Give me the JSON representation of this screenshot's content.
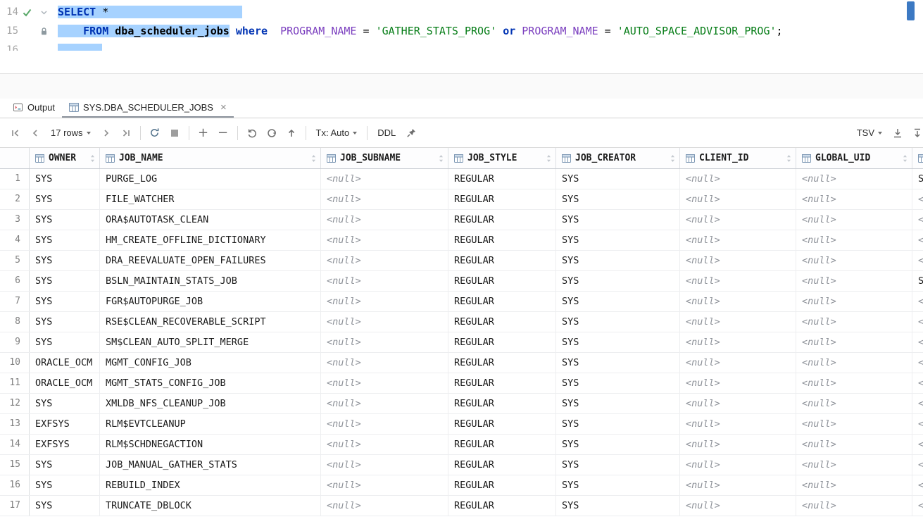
{
  "colors": {
    "selection": "#A6D2FF",
    "keyword": "#0033B3",
    "string": "#067D17",
    "field": "#7B3FBF",
    "scroll_marker": "#3C79C3",
    "null_text": "#8E9299"
  },
  "editor": {
    "lines": [
      {
        "number": "14",
        "g1": "check-icon",
        "g2": "fold-icon",
        "tokens": [
          {
            "t": "SELECT",
            "c": "kw",
            "s": true
          },
          {
            "t": " ",
            "c": "pln",
            "s": true
          },
          {
            "t": "*",
            "c": "pln",
            "s": true
          },
          {
            "t": "                     ",
            "c": "pln",
            "s": true
          }
        ]
      },
      {
        "number": "15",
        "g1": "",
        "g2": "lock-icon",
        "tokens": [
          {
            "t": "    ",
            "c": "pln",
            "s": true
          },
          {
            "t": "FROM",
            "c": "kw",
            "s": true
          },
          {
            "t": " ",
            "c": "pln",
            "s": true
          },
          {
            "t": "dba_scheduler_jobs",
            "c": "tbl",
            "s": true
          },
          {
            "t": " ",
            "c": "pln"
          },
          {
            "t": "where",
            "c": "kw"
          },
          {
            "t": "  ",
            "c": "pln"
          },
          {
            "t": "PROGRAM_NAME",
            "c": "fld"
          },
          {
            "t": " = ",
            "c": "pln"
          },
          {
            "t": "'GATHER_STATS_PROG'",
            "c": "str"
          },
          {
            "t": " ",
            "c": "pln"
          },
          {
            "t": "or",
            "c": "kw"
          },
          {
            "t": " ",
            "c": "pln"
          },
          {
            "t": "PROGRAM_NAME",
            "c": "fld"
          },
          {
            "t": " = ",
            "c": "pln"
          },
          {
            "t": "'AUTO_SPACE_ADVISOR_PROG'",
            "c": "str"
          },
          {
            "t": ";",
            "c": "pln"
          }
        ]
      },
      {
        "number": "16",
        "g1": "",
        "g2": "",
        "tokens": [
          {
            "t": "       ",
            "c": "pln",
            "s": true
          }
        ]
      }
    ]
  },
  "tabs": [
    {
      "label": "Output"
    },
    {
      "label": "SYS.DBA_SCHEDULER_JOBS"
    }
  ],
  "toolbar": {
    "rows_label": "17 rows",
    "tx_label": "Tx: Auto",
    "ddl_label": "DDL",
    "tsv_label": "TSV"
  },
  "grid": {
    "columns": [
      {
        "name": "OWNER"
      },
      {
        "name": "JOB_NAME"
      },
      {
        "name": "JOB_SUBNAME"
      },
      {
        "name": "JOB_STYLE"
      },
      {
        "name": "JOB_CREATOR"
      },
      {
        "name": "CLIENT_ID"
      },
      {
        "name": "GLOBAL_UID"
      },
      {
        "name": ""
      }
    ],
    "rows": [
      {
        "num": "1",
        "cells": [
          "SYS",
          "PURGE_LOG",
          "<null>",
          "REGULAR",
          "SYS",
          "<null>",
          "<null>",
          "SYS"
        ]
      },
      {
        "num": "2",
        "cells": [
          "SYS",
          "FILE_WATCHER",
          "<null>",
          "REGULAR",
          "SYS",
          "<null>",
          "<null>",
          "<null>"
        ]
      },
      {
        "num": "3",
        "cells": [
          "SYS",
          "ORA$AUTOTASK_CLEAN",
          "<null>",
          "REGULAR",
          "SYS",
          "<null>",
          "<null>",
          "<null>"
        ]
      },
      {
        "num": "4",
        "cells": [
          "SYS",
          "HM_CREATE_OFFLINE_DICTIONARY",
          "<null>",
          "REGULAR",
          "SYS",
          "<null>",
          "<null>",
          "<null>"
        ]
      },
      {
        "num": "5",
        "cells": [
          "SYS",
          "DRA_REEVALUATE_OPEN_FAILURES",
          "<null>",
          "REGULAR",
          "SYS",
          "<null>",
          "<null>",
          "<null>"
        ]
      },
      {
        "num": "6",
        "cells": [
          "SYS",
          "BSLN_MAINTAIN_STATS_JOB",
          "<null>",
          "REGULAR",
          "SYS",
          "<null>",
          "<null>",
          "SYS"
        ]
      },
      {
        "num": "7",
        "cells": [
          "SYS",
          "FGR$AUTOPURGE_JOB",
          "<null>",
          "REGULAR",
          "SYS",
          "<null>",
          "<null>",
          "<null>"
        ]
      },
      {
        "num": "8",
        "cells": [
          "SYS",
          "RSE$CLEAN_RECOVERABLE_SCRIPT",
          "<null>",
          "REGULAR",
          "SYS",
          "<null>",
          "<null>",
          "<null>"
        ]
      },
      {
        "num": "9",
        "cells": [
          "SYS",
          "SM$CLEAN_AUTO_SPLIT_MERGE",
          "<null>",
          "REGULAR",
          "SYS",
          "<null>",
          "<null>",
          "<null>"
        ]
      },
      {
        "num": "10",
        "cells": [
          "ORACLE_OCM",
          "MGMT_CONFIG_JOB",
          "<null>",
          "REGULAR",
          "SYS",
          "<null>",
          "<null>",
          "<null>"
        ]
      },
      {
        "num": "11",
        "cells": [
          "ORACLE_OCM",
          "MGMT_STATS_CONFIG_JOB",
          "<null>",
          "REGULAR",
          "SYS",
          "<null>",
          "<null>",
          "<null>"
        ]
      },
      {
        "num": "12",
        "cells": [
          "SYS",
          "XMLDB_NFS_CLEANUP_JOB",
          "<null>",
          "REGULAR",
          "SYS",
          "<null>",
          "<null>",
          "<null>"
        ]
      },
      {
        "num": "13",
        "cells": [
          "EXFSYS",
          "RLM$EVTCLEANUP",
          "<null>",
          "REGULAR",
          "SYS",
          "<null>",
          "<null>",
          "<null>"
        ]
      },
      {
        "num": "14",
        "cells": [
          "EXFSYS",
          "RLM$SCHDNEGACTION",
          "<null>",
          "REGULAR",
          "SYS",
          "<null>",
          "<null>",
          "<null>"
        ]
      },
      {
        "num": "15",
        "cells": [
          "SYS",
          "JOB_MANUAL_GATHER_STATS",
          "<null>",
          "REGULAR",
          "SYS",
          "<null>",
          "<null>",
          "<null>"
        ]
      },
      {
        "num": "16",
        "cells": [
          "SYS",
          "REBUILD_INDEX",
          "<null>",
          "REGULAR",
          "SYS",
          "<null>",
          "<null>",
          "<null>"
        ]
      },
      {
        "num": "17",
        "cells": [
          "SYS",
          "TRUNCATE_DBLOCK",
          "<null>",
          "REGULAR",
          "SYS",
          "<null>",
          "<null>",
          "<null>"
        ]
      }
    ]
  }
}
